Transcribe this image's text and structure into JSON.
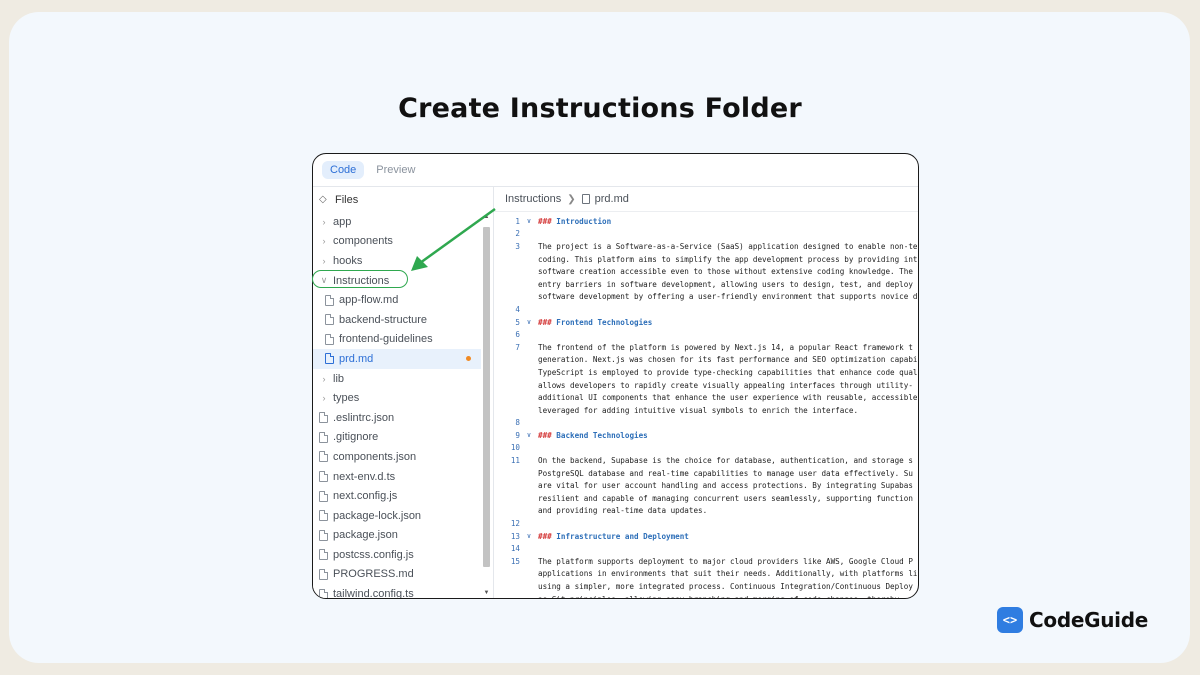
{
  "headline": "Create Instructions Folder",
  "tabs": [
    "Code",
    "Preview"
  ],
  "sidebar": {
    "title": "Files",
    "items": [
      {
        "label": "app",
        "kind": "folder"
      },
      {
        "label": "components",
        "kind": "folder"
      },
      {
        "label": "hooks",
        "kind": "folder"
      },
      {
        "label": "Instructions",
        "kind": "folder-open"
      },
      {
        "label": "app-flow.md",
        "kind": "file-child"
      },
      {
        "label": "backend-structure",
        "kind": "file-child"
      },
      {
        "label": "frontend-guidelines",
        "kind": "file-child"
      },
      {
        "label": "prd.md",
        "kind": "file-child",
        "selected": true,
        "modified": true
      },
      {
        "label": "lib",
        "kind": "folder"
      },
      {
        "label": "types",
        "kind": "folder"
      },
      {
        "label": ".eslintrc.json",
        "kind": "file"
      },
      {
        "label": ".gitignore",
        "kind": "file"
      },
      {
        "label": "components.json",
        "kind": "file"
      },
      {
        "label": "next-env.d.ts",
        "kind": "file"
      },
      {
        "label": "next.config.js",
        "kind": "file"
      },
      {
        "label": "package-lock.json",
        "kind": "file"
      },
      {
        "label": "package.json",
        "kind": "file"
      },
      {
        "label": "postcss.config.js",
        "kind": "file"
      },
      {
        "label": "PROGRESS.md",
        "kind": "file"
      },
      {
        "label": "tailwind.config.ts",
        "kind": "file"
      }
    ]
  },
  "breadcrumb": {
    "folder": "Instructions",
    "file": "prd.md"
  },
  "code_lines": [
    {
      "n": "1",
      "fold": true,
      "hash": "###",
      "text": "Introduction"
    },
    {
      "n": "2",
      "text": ""
    },
    {
      "n": "3",
      "text": "The project is a Software-as-a-Service (SaaS) application designed to enable non-te"
    },
    {
      "n": "",
      "text": "coding. This platform aims to simplify the app development process by providing int"
    },
    {
      "n": "",
      "text": "software creation accessible even to those without extensive coding knowledge. The"
    },
    {
      "n": "",
      "text": "entry barriers in software development, allowing users to design, test, and deploy"
    },
    {
      "n": "",
      "text": "software development by offering a user-friendly environment that supports novice d"
    },
    {
      "n": "4",
      "text": ""
    },
    {
      "n": "5",
      "fold": true,
      "hash": "###",
      "text": "Frontend Technologies"
    },
    {
      "n": "6",
      "text": ""
    },
    {
      "n": "7",
      "text": "The frontend of the platform is powered by Next.js 14, a popular React framework t"
    },
    {
      "n": "",
      "text": "generation. Next.js was chosen for its fast performance and SEO optimization capabi"
    },
    {
      "n": "",
      "text": "TypeScript is employed to provide type-checking capabilities that enhance code qual"
    },
    {
      "n": "",
      "text": "allows developers to rapidly create visually appealing interfaces through utility-"
    },
    {
      "n": "",
      "text": "additional UI components that enhance the user experience with reusable, accessible"
    },
    {
      "n": "",
      "text": "leveraged for adding intuitive visual symbols to enrich the interface."
    },
    {
      "n": "8",
      "text": ""
    },
    {
      "n": "9",
      "fold": true,
      "hash": "###",
      "text": "Backend Technologies"
    },
    {
      "n": "10",
      "text": ""
    },
    {
      "n": "11",
      "text": "On the backend, Supabase is the choice for database, authentication, and storage s"
    },
    {
      "n": "",
      "text": "PostgreSQL database and real-time capabilities to manage user data effectively. Su"
    },
    {
      "n": "",
      "text": "are vital for user account handling and access protections. By integrating Supabas"
    },
    {
      "n": "",
      "text": "resilient and capable of managing concurrent users seamlessly, supporting function"
    },
    {
      "n": "",
      "text": "and providing real-time data updates."
    },
    {
      "n": "12",
      "text": ""
    },
    {
      "n": "13",
      "fold": true,
      "hash": "###",
      "text": "Infrastructure and Deployment"
    },
    {
      "n": "14",
      "text": ""
    },
    {
      "n": "15",
      "text": "The platform supports deployment to major cloud providers like AWS, Google Cloud P"
    },
    {
      "n": "",
      "text": "applications in environments that suit their needs. Additionally, with platforms li"
    },
    {
      "n": "",
      "text": "using a simpler, more integrated process. Continuous Integration/Continuous Deploy"
    },
    {
      "n": "",
      "text": "as Git principles, allowing easy branching and merging of code changes, thereby"
    }
  ],
  "brand": {
    "name": "CodeGuide",
    "logo_glyph": "<>"
  },
  "colors": {
    "accent": "#2d6fd6",
    "highlight_ring": "#2fa84f",
    "modified_dot": "#f08a24",
    "logo": "#2f7de1"
  }
}
